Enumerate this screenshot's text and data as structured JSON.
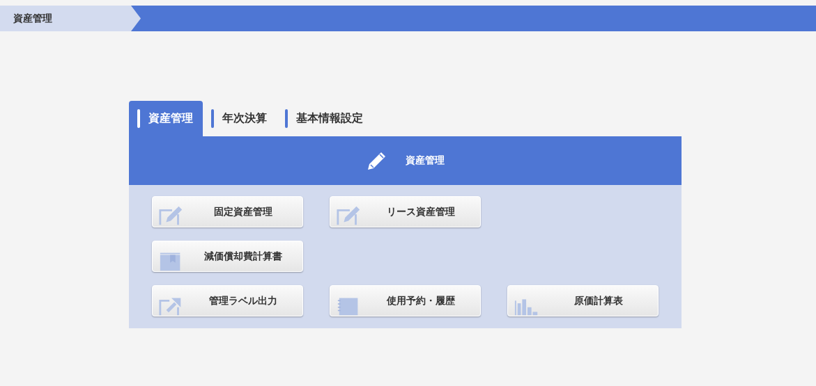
{
  "breadcrumb": {
    "label": "資産管理"
  },
  "tabs": [
    {
      "label": "資産管理",
      "selected": true
    },
    {
      "label": "年次決算",
      "selected": false
    },
    {
      "label": "基本情報設定",
      "selected": false
    }
  ],
  "panel": {
    "title": "資産管理",
    "rows": [
      [
        {
          "label": "固定資産管理",
          "kind": "edit"
        },
        {
          "label": "リース資産管理",
          "kind": "edit"
        }
      ],
      [
        {
          "label": "減価償却費計算書",
          "kind": "book"
        }
      ],
      [
        {
          "label": "管理ラベル出力",
          "kind": "export"
        },
        {
          "label": "使用予約・履歴",
          "kind": "notebook"
        },
        {
          "label": "原価計算表",
          "kind": "chart"
        }
      ]
    ]
  }
}
